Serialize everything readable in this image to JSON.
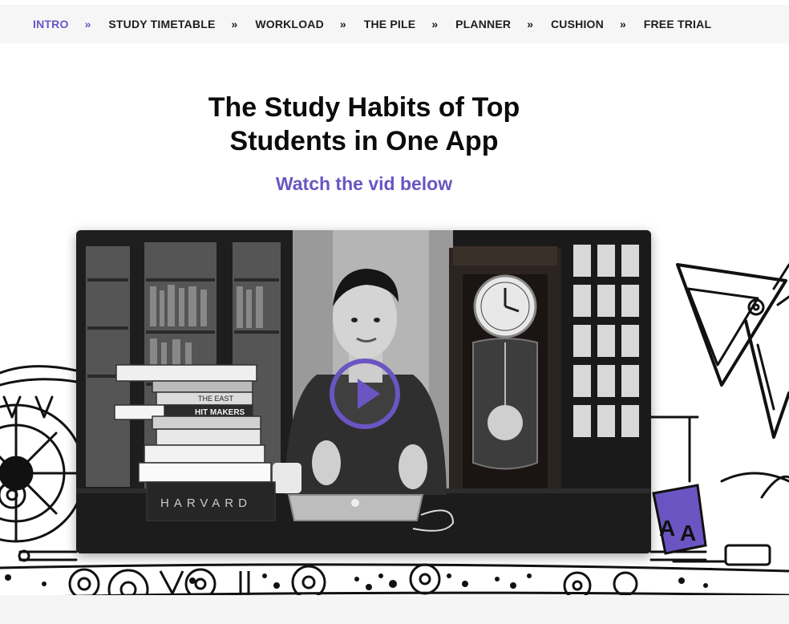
{
  "nav": {
    "items": [
      {
        "label": "INTRO",
        "active": true
      },
      {
        "label": "STUDY TIMETABLE",
        "active": false
      },
      {
        "label": "WORKLOAD",
        "active": false
      },
      {
        "label": "THE PILE",
        "active": false
      },
      {
        "label": "PLANNER",
        "active": false
      },
      {
        "label": "CUSHION",
        "active": false
      },
      {
        "label": "FREE TRIAL",
        "active": false
      }
    ],
    "separator": "»"
  },
  "hero": {
    "title_line1": "The Study Habits of Top",
    "title_line2": "Students in One App",
    "subtitle": "Watch the vid below"
  },
  "video": {
    "book_spine_text": "HARVARD",
    "book_label_1": "HIT MAKERS",
    "book_label_2": "THE EAST",
    "play_icon": "play-circle-icon"
  },
  "colors": {
    "accent": "#6a55c2",
    "nav_bg": "#f6f6f7",
    "text": "#0b0b0b"
  }
}
